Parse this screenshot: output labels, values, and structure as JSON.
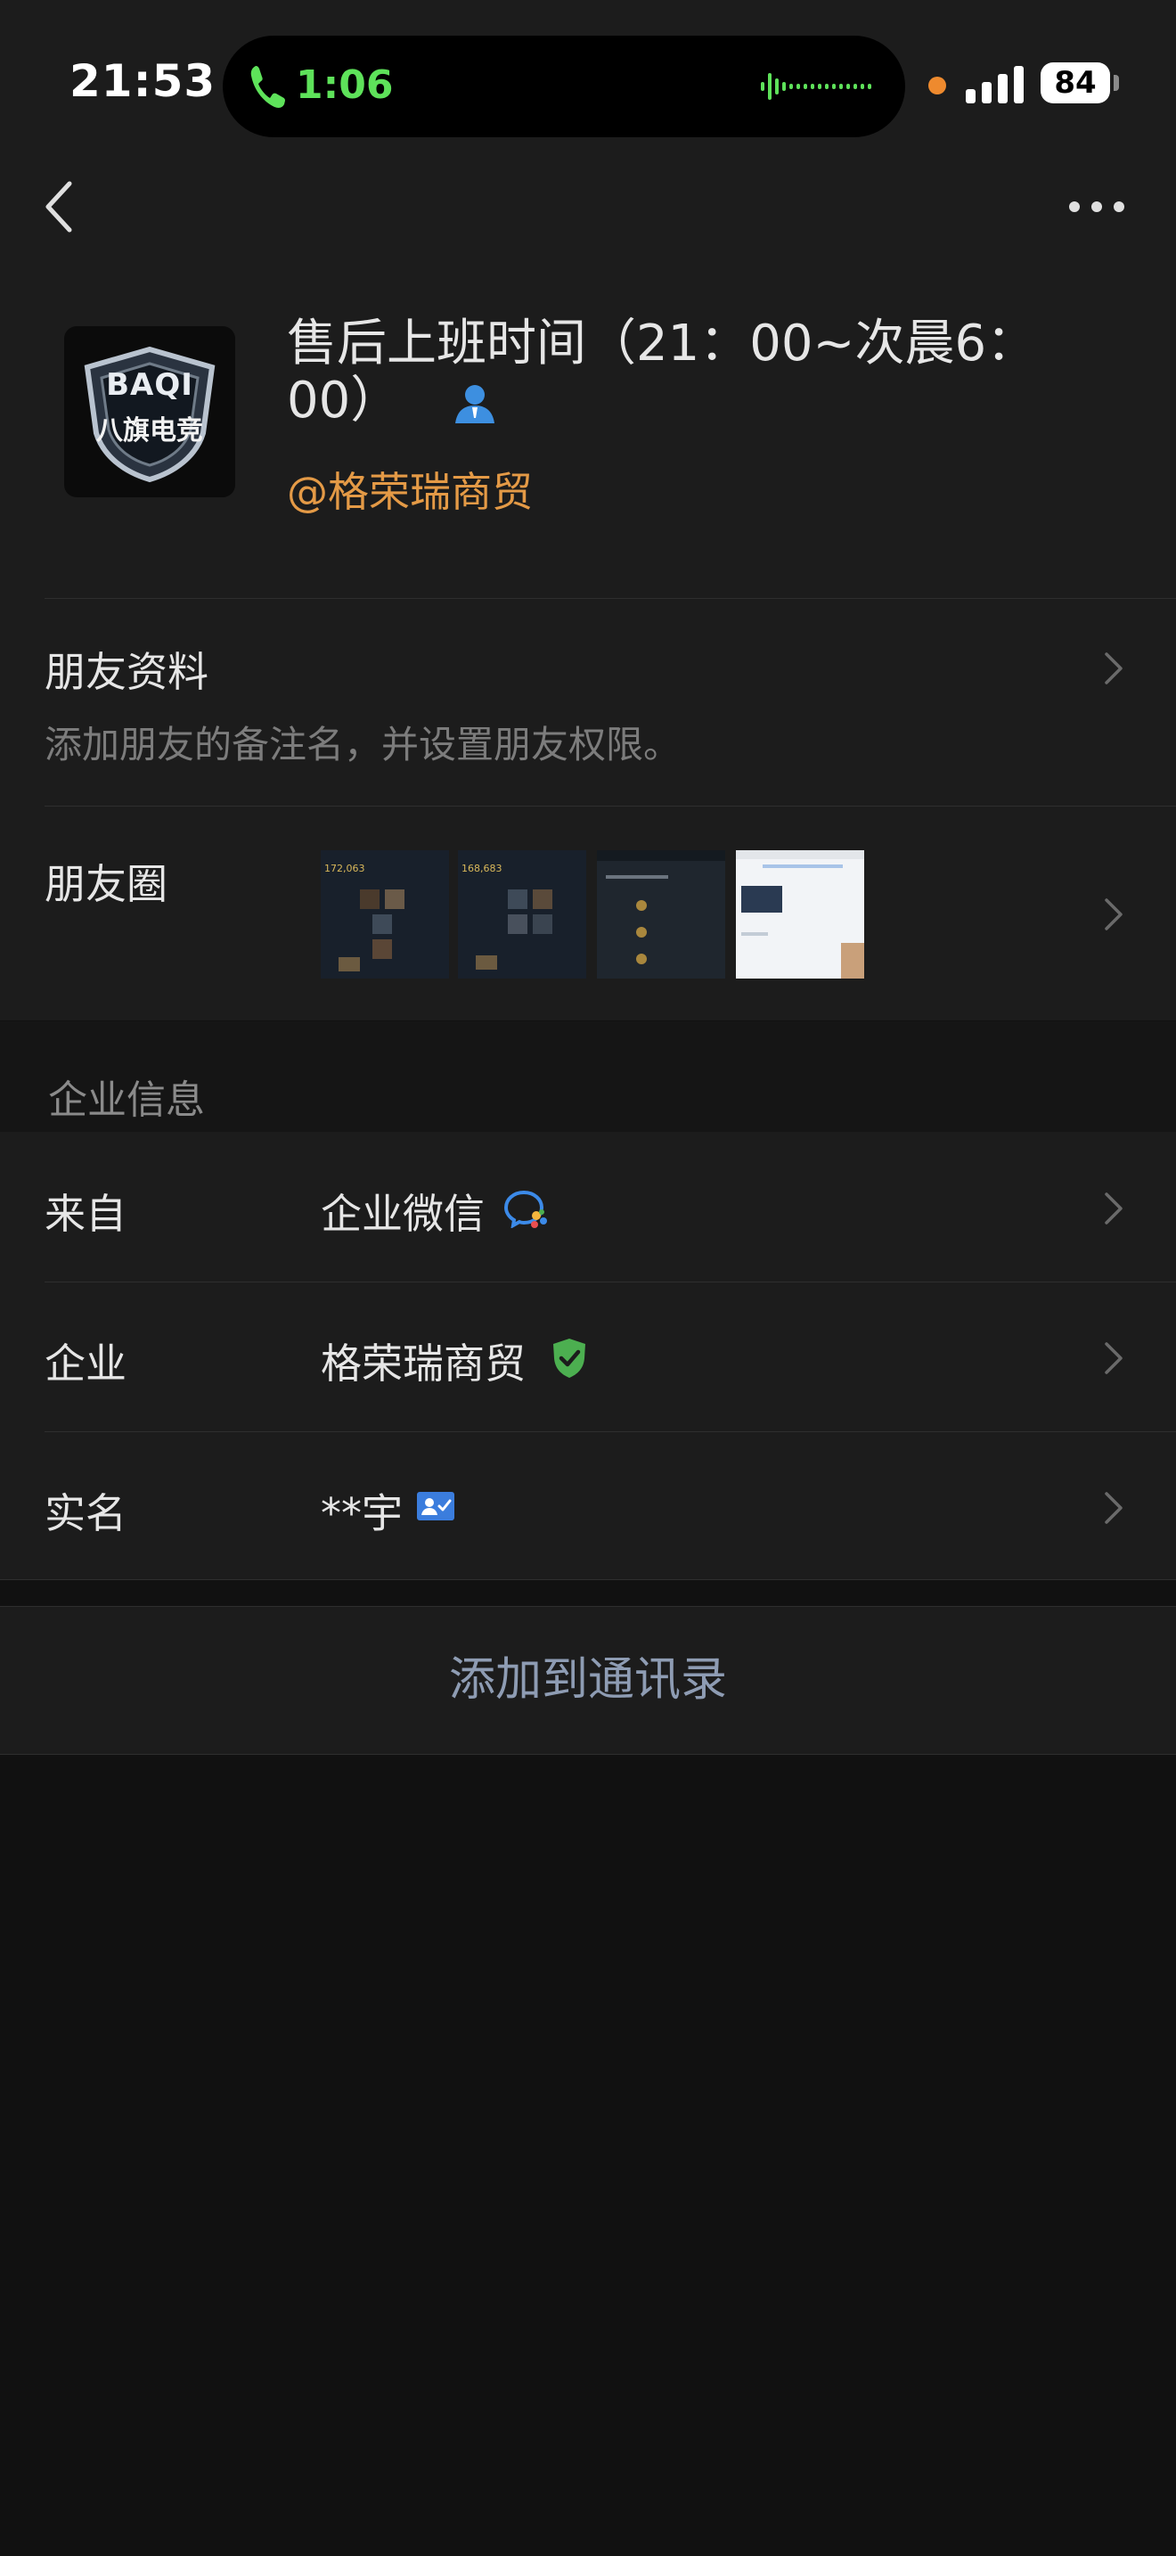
{
  "status_bar": {
    "time": "21:53",
    "call_duration": "1:06",
    "battery": "84"
  },
  "profile": {
    "name": "售后上班时间（21：00~次晨6：00）",
    "company_tag": "@格荣瑞商贸",
    "avatar_text_top": "BAQI",
    "avatar_text_bottom": "八旗电竞"
  },
  "friend_info": {
    "title": "朋友资料",
    "description": "添加朋友的备注名，并设置朋友权限。"
  },
  "moments": {
    "label": "朋友圈",
    "thumbnail_texts": [
      "172,063",
      "168,683"
    ]
  },
  "enterprise": {
    "section_title": "企业信息",
    "rows": [
      {
        "label": "来自",
        "value": "企业微信"
      },
      {
        "label": "企业",
        "value": "格荣瑞商贸"
      },
      {
        "label": "实名",
        "value": "**宇"
      }
    ]
  },
  "actions": {
    "add_to_contacts": "添加到通讯录"
  },
  "colors": {
    "background": "#111111",
    "panel": "#1c1c1c",
    "company_tag": "#e49a46",
    "call_green": "#5ee25a",
    "verified_green": "#4caf50",
    "realname_blue": "#3b7ddd",
    "button_text": "#8e9cb3"
  },
  "icons": [
    "phone-icon",
    "waveform-icon",
    "signal-icon",
    "back-chevron-icon",
    "more-icon",
    "person-icon",
    "chevron-right-icon",
    "wecom-icon",
    "verified-shield-icon",
    "realname-card-icon"
  ]
}
